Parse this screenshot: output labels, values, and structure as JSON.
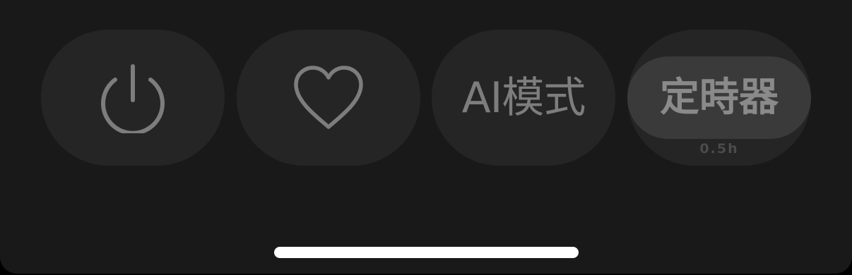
{
  "controls": {
    "power": {
      "icon": "power-icon"
    },
    "favorite": {
      "icon": "heart-icon"
    },
    "ai_mode": {
      "label": "AI模式"
    },
    "timer": {
      "label": "定時器",
      "value": "0.5h"
    }
  },
  "colors": {
    "panel_background": "#191919",
    "button_background": "#252525",
    "timer_highlight": "#3a3a3a",
    "icon_and_text": "#7d7d7d",
    "home_indicator": "#ffffff"
  }
}
